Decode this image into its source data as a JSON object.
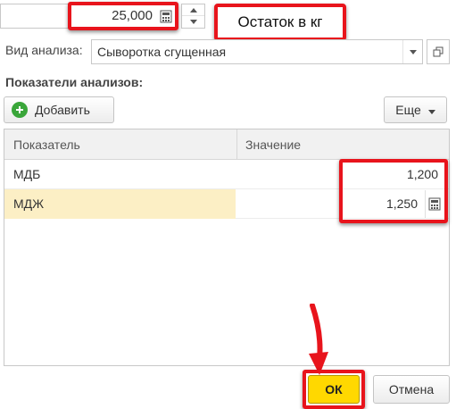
{
  "quantity": {
    "value": "25,000"
  },
  "callout": {
    "text": "Остаток в кг"
  },
  "analysis": {
    "label": "Вид анализа:",
    "value": "Сыворотка сгущенная"
  },
  "section": {
    "title": "Показатели анализов:"
  },
  "toolbar": {
    "add_label": "Добавить",
    "more_label": "Еще"
  },
  "table": {
    "headers": [
      "Показатель",
      "Значение"
    ],
    "rows": [
      {
        "indicator": "МДБ",
        "value": "1,200"
      },
      {
        "indicator": "МДЖ",
        "value": "1,250"
      }
    ]
  },
  "footer": {
    "ok_label": "ОК",
    "cancel_label": "Отмена"
  },
  "colors": {
    "highlight": "#e8141c",
    "ok_button": "#ffd800",
    "selected_row": "#fcefc5",
    "add_icon": "#3aa63a"
  },
  "icons": [
    "calculator-icon",
    "spinner-up-icon",
    "spinner-down-icon",
    "chevron-down-icon",
    "open-form-icon",
    "plus-circle-icon",
    "red-arrow"
  ]
}
